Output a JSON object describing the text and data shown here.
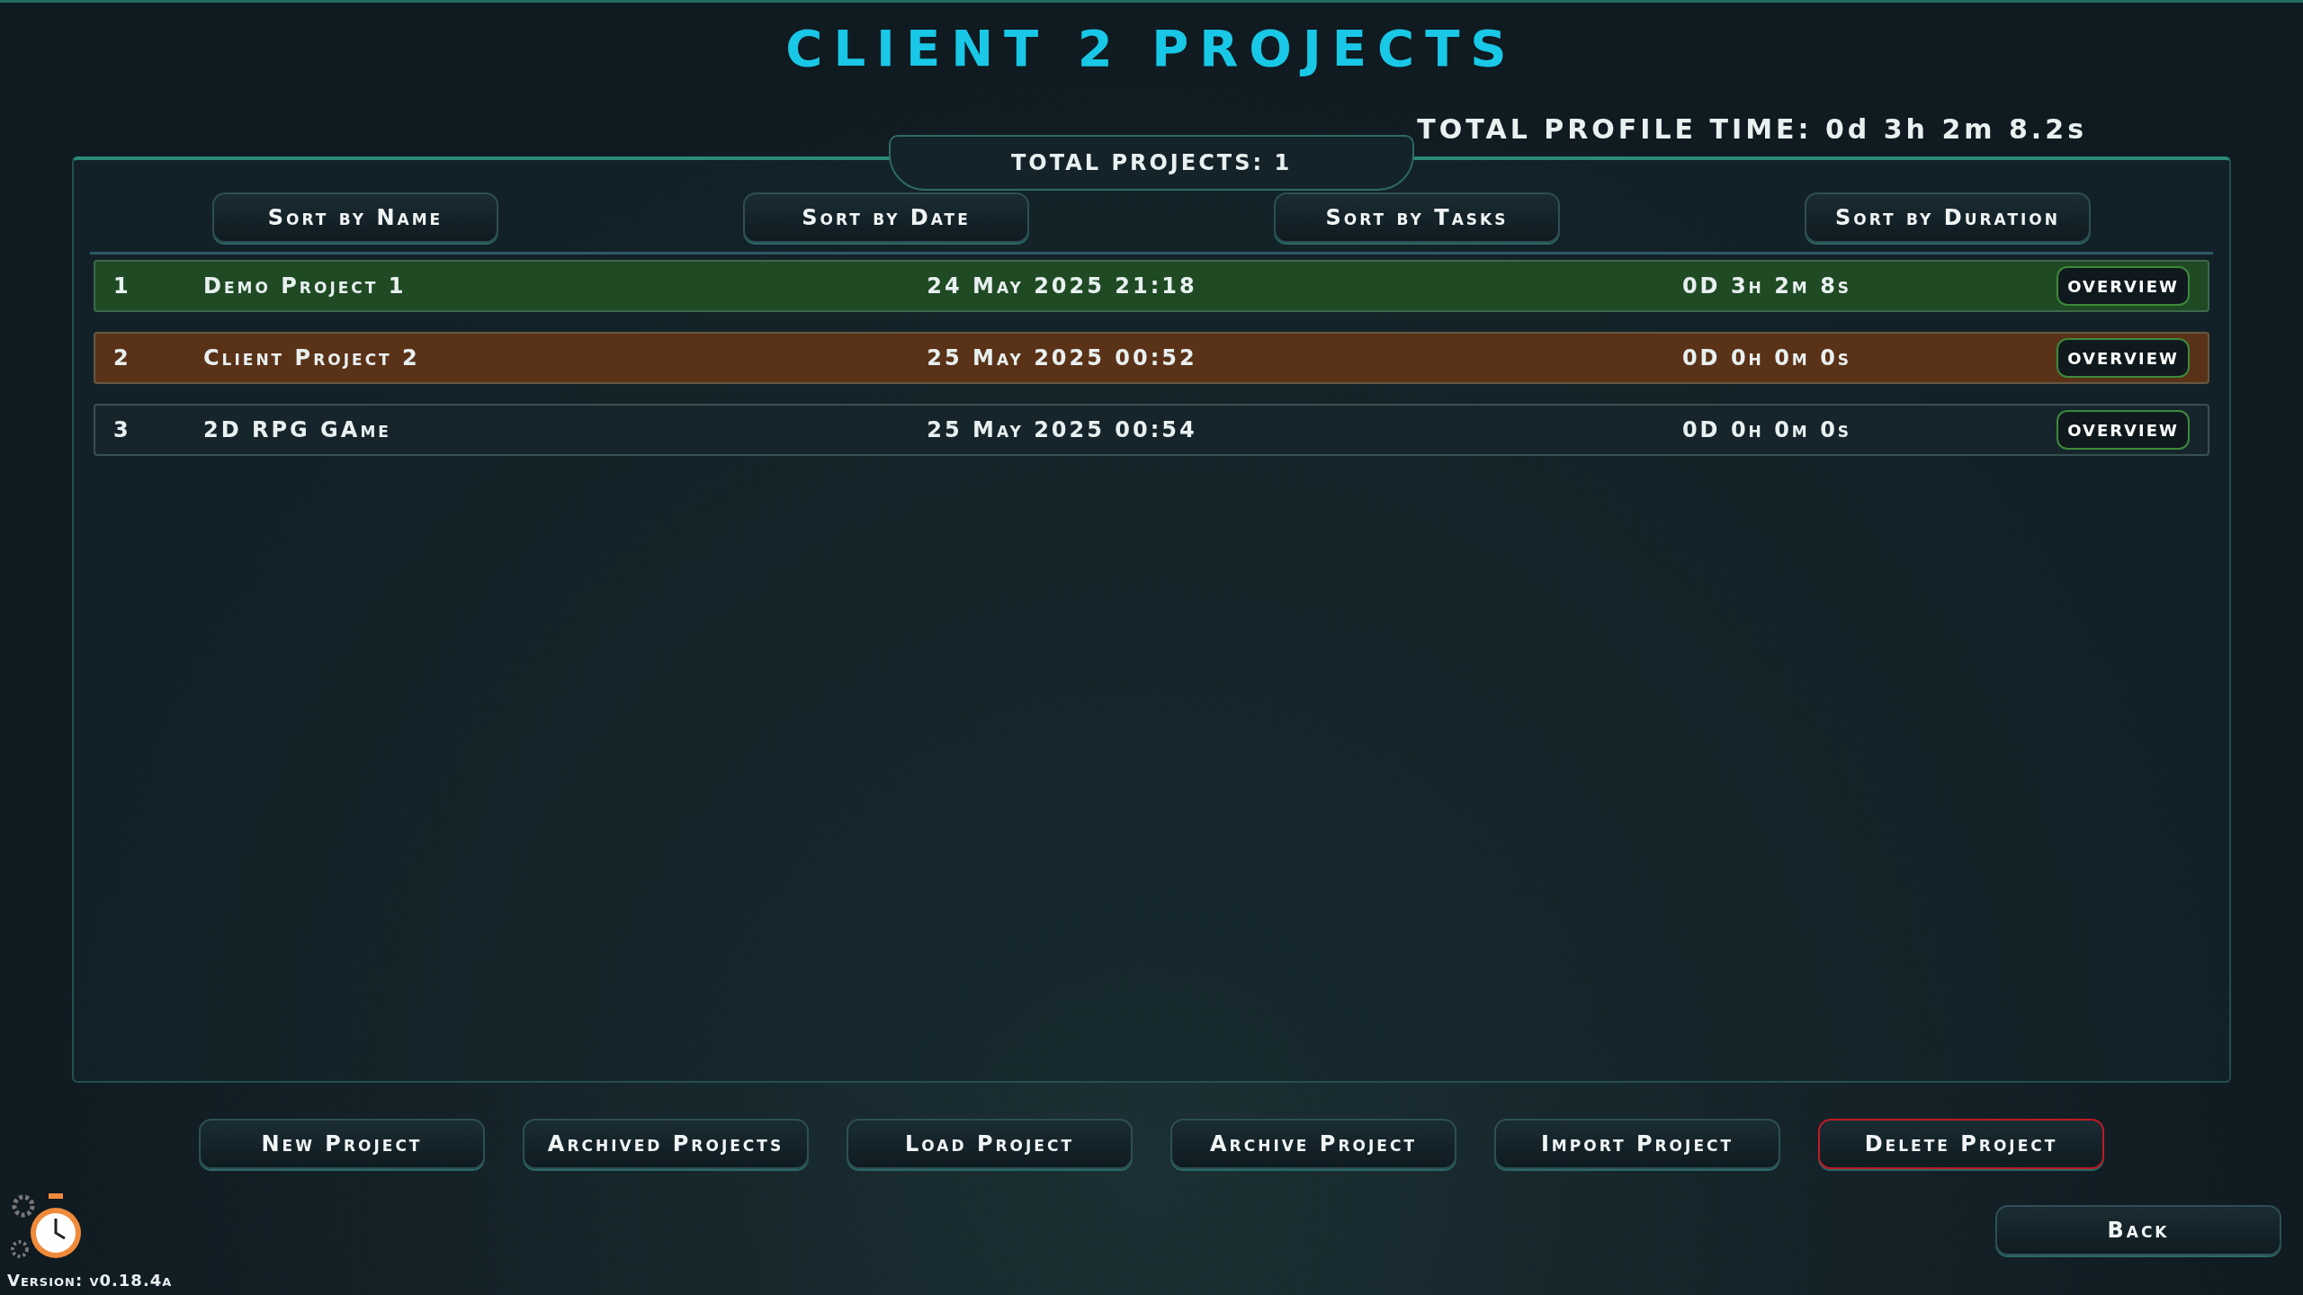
{
  "title": "CLIENT 2 PROJECTS",
  "total_profile_time": "TOTAL PROFILE TIME: 0d 3h 2m 8.2s",
  "total_projects": "TOTAL PROJECTS: 1",
  "sort_buttons": [
    "Sort by Name",
    "Sort by Date",
    "Sort by Tasks",
    "Sort by Duration"
  ],
  "rows": [
    {
      "index": "1",
      "name": "Demo Project 1",
      "date": "24 May 2025 21:18",
      "duration": "0D 3h 2m 8s",
      "action": "OVERVIEW",
      "color": "#1f4a24"
    },
    {
      "index": "2",
      "name": "Client Project 2",
      "date": "25 May 2025 00:52",
      "duration": "0D 0h 0m 0s",
      "action": "OVERVIEW",
      "color": "#5a3218"
    },
    {
      "index": "3",
      "name": "2D RPG GAme",
      "date": "25 May 2025 00:54",
      "duration": "0D 0h 0m 0s",
      "action": "OVERVIEW",
      "color": "#16252c"
    }
  ],
  "actions": [
    {
      "label": "New Project",
      "kind": "normal"
    },
    {
      "label": "Archived Projects",
      "kind": "normal"
    },
    {
      "label": "Load Project",
      "kind": "normal"
    },
    {
      "label": "Archive Project",
      "kind": "normal"
    },
    {
      "label": "Import Project",
      "kind": "normal"
    },
    {
      "label": "Delete Project",
      "kind": "danger"
    }
  ],
  "back": "Back",
  "version": "Version: v0.18.4a"
}
